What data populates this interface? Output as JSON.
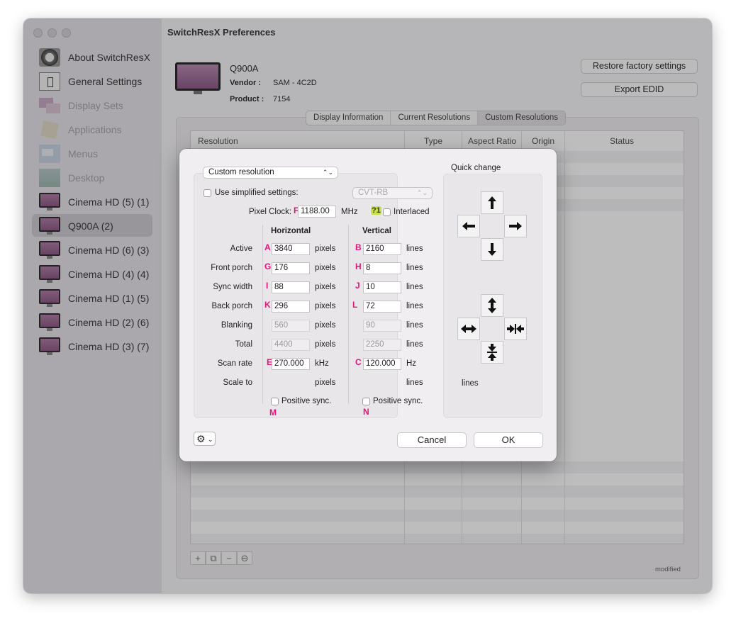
{
  "window": {
    "title": "SwitchResX Preferences"
  },
  "sidebar": {
    "items": [
      {
        "label": "About SwitchResX",
        "icon": "about-icon"
      },
      {
        "label": "General Settings",
        "icon": "general-settings-icon"
      },
      {
        "label": "Display Sets",
        "icon": "display-sets-icon"
      },
      {
        "label": "Applications",
        "icon": "applications-icon"
      },
      {
        "label": "Menus",
        "icon": "menus-icon"
      },
      {
        "label": "Desktop",
        "icon": "desktop-icon"
      },
      {
        "label": "Cinema HD (5) (1)",
        "icon": "monitor-icon"
      },
      {
        "label": "Q900A (2)",
        "icon": "monitor-icon"
      },
      {
        "label": "Cinema HD (6) (3)",
        "icon": "monitor-icon"
      },
      {
        "label": "Cinema HD (4) (4)",
        "icon": "monitor-icon"
      },
      {
        "label": "Cinema HD (1) (5)",
        "icon": "monitor-icon"
      },
      {
        "label": "Cinema HD (2) (6)",
        "icon": "monitor-icon"
      },
      {
        "label": "Cinema HD (3) (7)",
        "icon": "monitor-icon"
      }
    ]
  },
  "display": {
    "name": "Q900A",
    "vendor_key": "Vendor :",
    "vendor_value": "SAM - 4C2D",
    "product_key": "Product :",
    "product_value": "7154",
    "restore_button": "Restore factory settings",
    "export_button": "Export EDID"
  },
  "tabs": [
    "Display Information",
    "Current Resolutions",
    "Custom Resolutions"
  ],
  "table": {
    "columns": [
      "Resolution",
      "Type",
      "Aspect Ratio",
      "Origin",
      "Status"
    ]
  },
  "footer": {
    "modified": "modified"
  },
  "dialog": {
    "mode": "Custom resolution",
    "simplified_label": "Use simplified settings:",
    "simplified_value": "CVT-RB",
    "pixel_clock_label": "Pixel Clock:",
    "pixel_clock_value": "1188.00",
    "pixel_clock_unit": "MHz",
    "interlaced_label": "Interlaced",
    "horizontal_header": "Horizontal",
    "vertical_header": "Vertical",
    "rows": [
      {
        "label": "Active",
        "h_marker": "A",
        "h_value": "3840",
        "h_unit": "pixels",
        "v_marker": "B",
        "v_value": "2160",
        "v_unit": "lines",
        "readonly": false
      },
      {
        "label": "Front porch",
        "h_marker": "G",
        "h_value": "176",
        "h_unit": "pixels",
        "v_marker": "H",
        "v_value": "8",
        "v_unit": "lines",
        "readonly": false
      },
      {
        "label": "Sync width",
        "h_marker": "I",
        "h_value": "88",
        "h_unit": "pixels",
        "v_marker": "J",
        "v_value": "10",
        "v_unit": "lines",
        "readonly": false
      },
      {
        "label": "Back porch",
        "h_marker": "K",
        "h_value": "296",
        "h_unit": "pixels",
        "v_marker": "L",
        "v_value": "72",
        "v_unit": "lines",
        "readonly": false
      },
      {
        "label": "Blanking",
        "h_marker": "",
        "h_value": "560",
        "h_unit": "pixels",
        "v_marker": "",
        "v_value": "90",
        "v_unit": "lines",
        "readonly": true
      },
      {
        "label": "Total",
        "h_marker": "",
        "h_value": "4400",
        "h_unit": "pixels",
        "v_marker": "",
        "v_value": "2250",
        "v_unit": "lines",
        "readonly": true
      },
      {
        "label": "Scan rate",
        "h_marker": "E",
        "h_value": "270.000",
        "h_unit": "kHz",
        "v_marker": "C",
        "v_value": "120.000",
        "v_unit": "Hz",
        "readonly": false
      },
      {
        "label": "Scale to",
        "h_marker": "",
        "h_value": "",
        "h_unit": "pixels",
        "v_marker": "",
        "v_value": "",
        "v_unit": "lines",
        "readonly": false
      }
    ],
    "pixel_clock_marker": "F",
    "interlaced_marker": "?1",
    "h_sync_label": "Positive sync.",
    "h_sync_marker": "M",
    "v_sync_label": "Positive sync.",
    "v_sync_marker": "N",
    "quick_change_label": "Quick change",
    "quick_change_unit": "lines",
    "cancel_button": "Cancel",
    "ok_button": "OK"
  }
}
